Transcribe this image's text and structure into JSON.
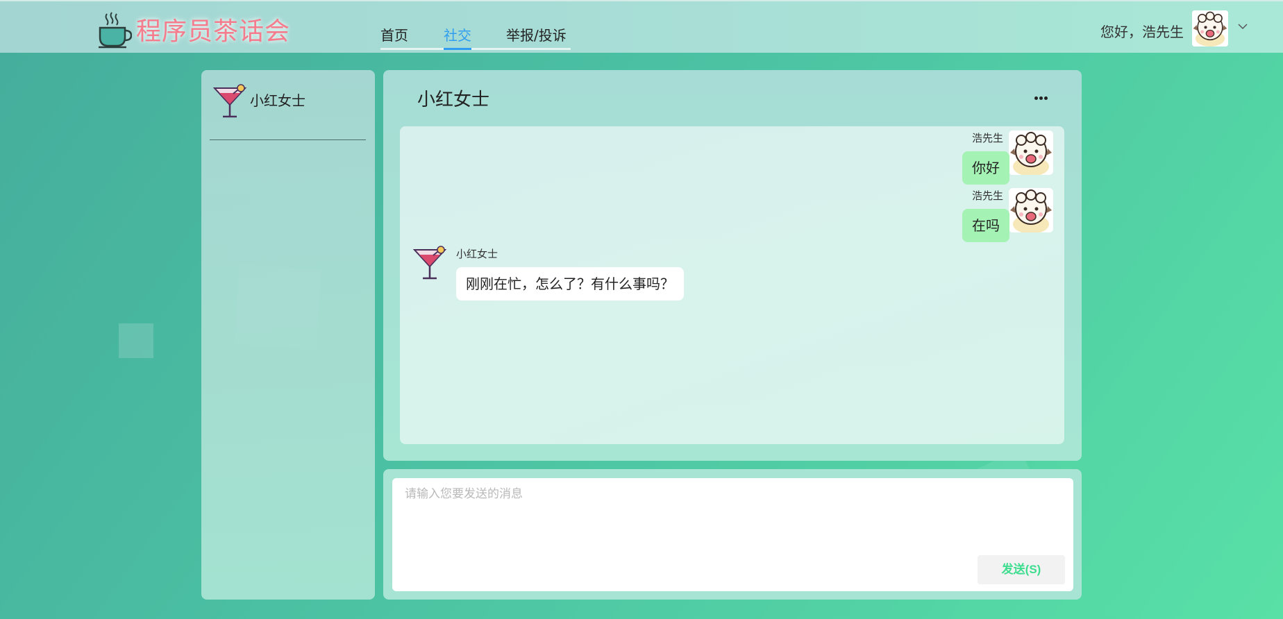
{
  "app": {
    "logo_text": "程序员茶话会"
  },
  "nav": {
    "items": [
      {
        "label": "首页",
        "active": false
      },
      {
        "label": "社交",
        "active": true
      },
      {
        "label": "举报/投诉",
        "active": false
      }
    ],
    "active_color": "#2f9df0"
  },
  "user": {
    "greeting": "您好，浩先生",
    "avatar_icon": "sheep-avatar-icon"
  },
  "contacts": {
    "items": [
      {
        "name": "小红女士",
        "avatar_icon": "cocktail-avatar-icon"
      }
    ]
  },
  "chat": {
    "title": "小红女士",
    "more_icon": "more-dots-icon",
    "messages": [
      {
        "sender": "浩先生",
        "text": "你好",
        "from_me": true
      },
      {
        "sender": "浩先生",
        "text": "在吗",
        "from_me": true
      },
      {
        "sender": "小红女士",
        "text": "刚刚在忙，怎么了？有什么事吗？",
        "from_me": false
      }
    ]
  },
  "composer": {
    "placeholder": "请输入您要发送的消息",
    "send_label": "发送(S)"
  },
  "colors": {
    "brand_pink": "#f47c8c",
    "bubble_me": "#a4f2b4",
    "bubble_them": "#ffffff",
    "send_text": "#3ddd8f"
  }
}
